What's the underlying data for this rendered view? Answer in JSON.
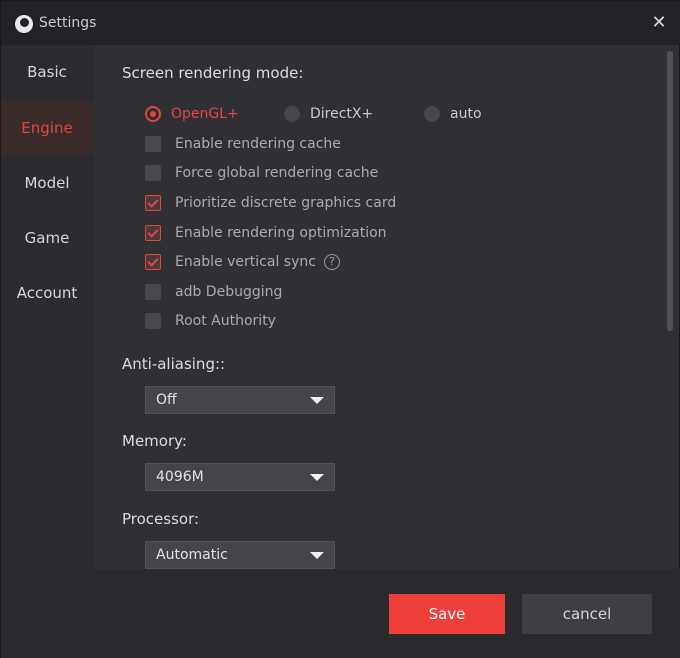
{
  "window": {
    "title": "Settings",
    "accent_color": "#e2473f"
  },
  "sidebar": {
    "items": [
      {
        "label": "Basic",
        "active": false
      },
      {
        "label": "Engine",
        "active": true
      },
      {
        "label": "Model",
        "active": false
      },
      {
        "label": "Game",
        "active": false
      },
      {
        "label": "Account",
        "active": false
      }
    ]
  },
  "engine": {
    "rendering_mode": {
      "label": "Screen rendering mode:",
      "options": [
        {
          "label": "OpenGL+",
          "selected": true
        },
        {
          "label": "DirectX+",
          "selected": false
        },
        {
          "label": "auto",
          "selected": false
        }
      ]
    },
    "checkboxes": [
      {
        "label": "Enable rendering cache",
        "checked": false
      },
      {
        "label": "Force global rendering cache",
        "checked": false
      },
      {
        "label": "Prioritize discrete graphics card",
        "checked": true
      },
      {
        "label": "Enable rendering optimization",
        "checked": true
      },
      {
        "label": "Enable vertical sync",
        "checked": true,
        "help_icon": "question-icon"
      },
      {
        "label": "adb Debugging",
        "checked": false
      },
      {
        "label": "Root Authority",
        "checked": false
      }
    ],
    "anti_aliasing": {
      "label": "Anti-aliasing::",
      "value": "Off"
    },
    "memory": {
      "label": "Memory:",
      "value": "4096M"
    },
    "processor": {
      "label": "Processor:",
      "value": "Automatic"
    }
  },
  "footer": {
    "save_label": "Save",
    "cancel_label": "cancel"
  }
}
